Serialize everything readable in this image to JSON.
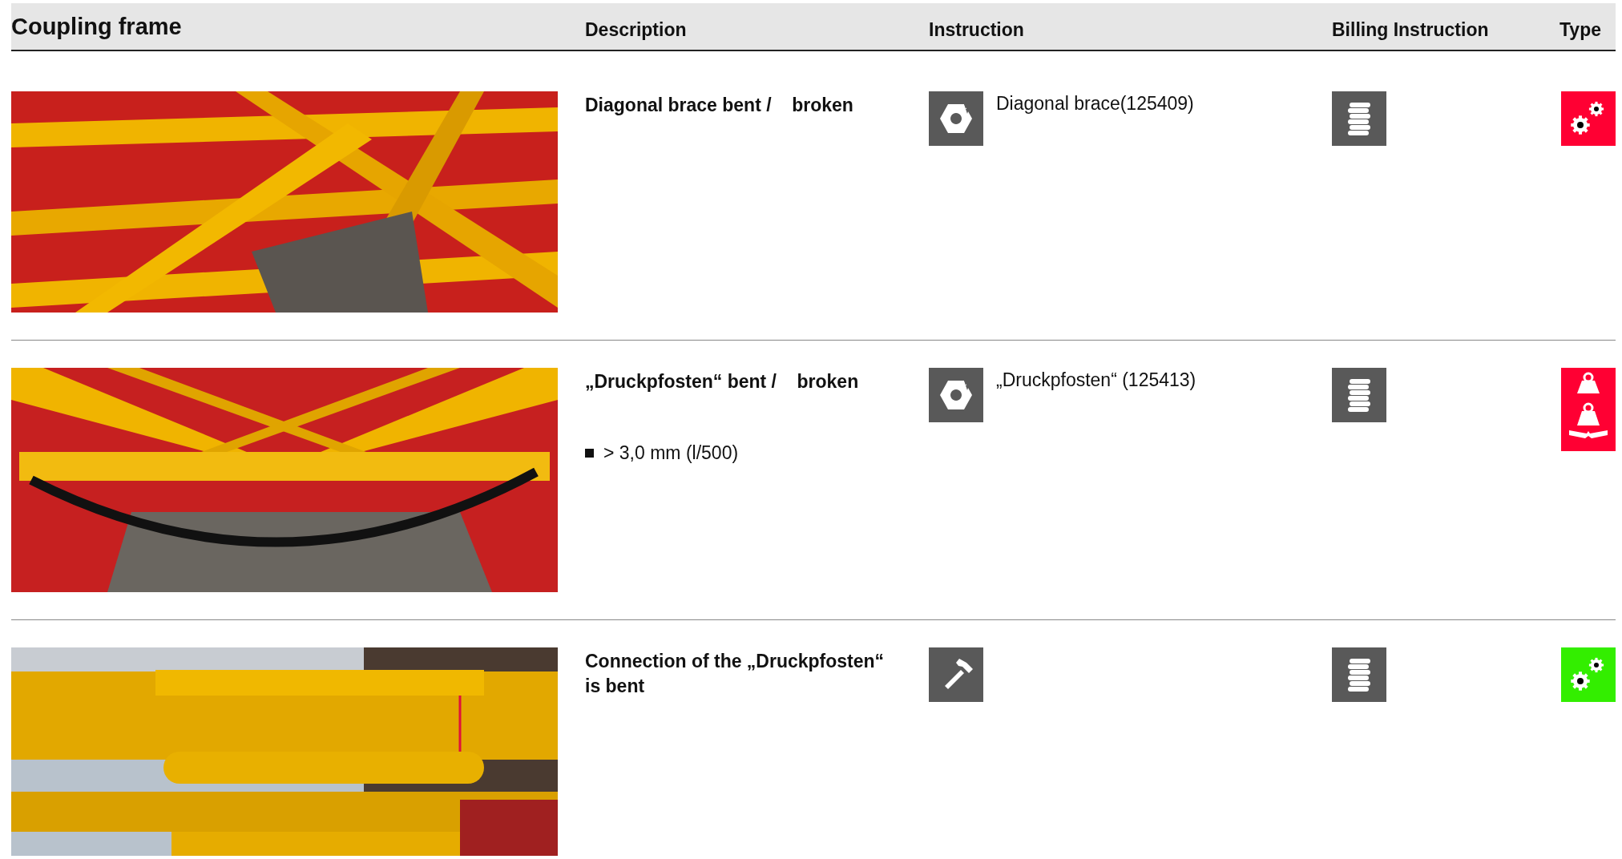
{
  "header": {
    "title": "Coupling frame",
    "columns": [
      "Description",
      "Instruction",
      "Billing Instruction",
      "Type"
    ]
  },
  "rows": [
    {
      "photo": {
        "kind": "picture"
      },
      "description": {
        "title": "Diagonal brace bent /    broken"
      },
      "instruction": {
        "kind": "nut",
        "text": "Diagonal brace(125409)"
      },
      "billing": {
        "kind": "coins"
      },
      "type_icons": [
        {
          "kind": "gears",
          "color": "#ff0033"
        }
      ]
    },
    {
      "photo": {
        "kind": "picture"
      },
      "description": {
        "title": "„Druckpfosten“ bent /    broken",
        "bullets": [
          "> 3,0 mm (l/500)"
        ]
      },
      "instruction": {
        "kind": "nut",
        "text": "„Druckpfosten“ (125413)"
      },
      "billing": {
        "kind": "coins"
      },
      "type_icons": [
        {
          "kind": "weight",
          "color": "#ff0033"
        },
        {
          "kind": "weight-broken",
          "color": "#ff0033"
        }
      ]
    },
    {
      "photo": {
        "kind": "picture"
      },
      "description": {
        "title": "Connection of the „Druckpfosten“ is bent"
      },
      "instruction": {
        "kind": "hammer"
      },
      "billing": {
        "kind": "coins"
      },
      "type_icons": [
        {
          "kind": "gears",
          "color": "#33ee00"
        }
      ]
    }
  ]
}
